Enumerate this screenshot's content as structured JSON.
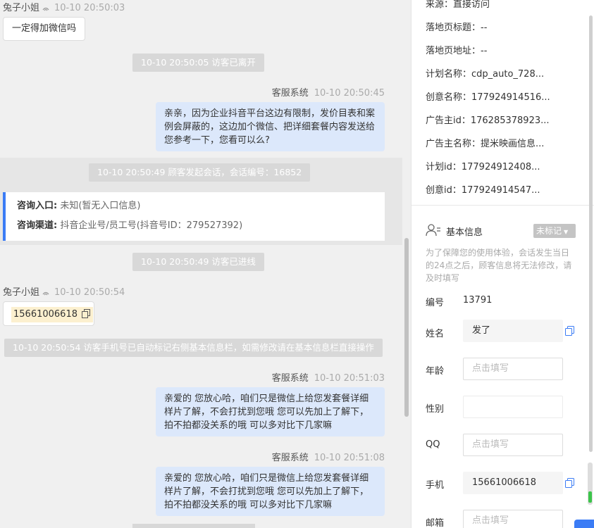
{
  "chat": {
    "msg1": {
      "sender": "兔子小姐",
      "time": "10-10 20:50:03",
      "text": "一定得加微信吗"
    },
    "sys_leave": "10-10 20:50:05 访客已离开",
    "msg2": {
      "sender": "客服系统",
      "time": "10-10 20:50:45",
      "lines": [
        "亲亲，因为企业抖音平台这边有限制，发价目表和案",
        "例会屏蔽的，这边加个微信、把详细套餐内容发送给",
        "您参考一下，您看可以么?"
      ]
    },
    "sys_session": "10-10 20:50:49 顾客发起会话，会话编号：16852",
    "entry": {
      "label1": "咨询入口:",
      "value1": "未知(暂无入口信息)",
      "label2": "咨询渠道:",
      "value2": "抖音企业号/员工号(抖音号ID：279527392)"
    },
    "sys_online": "10-10 20:50:49 访客已进线",
    "msg3": {
      "sender": "兔子小姐",
      "time": "10-10 20:50:54",
      "phone": "15661006618"
    },
    "sys_phone": "10-10 20:50:54 访客手机号已自动标记右侧基本信息栏，如需修改请在基本信息栏直接操作",
    "msg4": {
      "sender": "客服系统",
      "time": "10-10 20:51:03",
      "lines": [
        "亲爱的 您放心哈，咱们只是微信上给您发套餐详细",
        "样片了解，不会打扰到您哦 您可以先加上了解下，",
        "拍不拍都没关系的哦 可以多对比下几家嘛"
      ]
    },
    "msg5": {
      "sender": "客服系统",
      "time": "10-10 20:51:08",
      "lines": [
        "亲爱的 您放心哈，咱们只是微信上给您发套餐详细",
        "样片了解，不会打扰到您哦 您可以先加上了解下，",
        "拍不拍都没关系的哦 可以多对比下几家嘛"
      ]
    }
  },
  "panel": {
    "source": "来源：直接访问",
    "landing_title": "落地页标题：--",
    "landing_url": "落地页地址：--",
    "plan_name": "计划名称：cdp_auto_728...",
    "creative_name": "创意名称：177924914516...",
    "advertiser_id": "广告主id：176285378923...",
    "advertiser_name": "广告主名称：提米映画信息...",
    "plan_id": "计划id：177924912408...",
    "creative_id": "创意id：177924914547...",
    "basic_title": "基本信息",
    "tag_label": "未标记",
    "notice": [
      "为了保障您的使用体验，会话发生当日",
      "的24点之后，顾客信息将无法修改，请",
      "及时填写"
    ],
    "id_label": "编号",
    "id_value": "13791",
    "fields": {
      "name": {
        "label": "姓名",
        "value": "发了"
      },
      "age": {
        "label": "年龄",
        "placeholder": "点击填写"
      },
      "gender": {
        "label": "性别",
        "value": ""
      },
      "qq": {
        "label": "QQ",
        "placeholder": "点击填写"
      },
      "phone": {
        "label": "手机",
        "value": "15661006618"
      },
      "email": {
        "label": "邮箱",
        "placeholder": "点击填写"
      }
    }
  },
  "colors": {
    "accent": "#3b7cf5",
    "bubble_right": "#dce8fb",
    "pill": "#d8d8d8",
    "phone_highlight": "#fcf0cf"
  }
}
